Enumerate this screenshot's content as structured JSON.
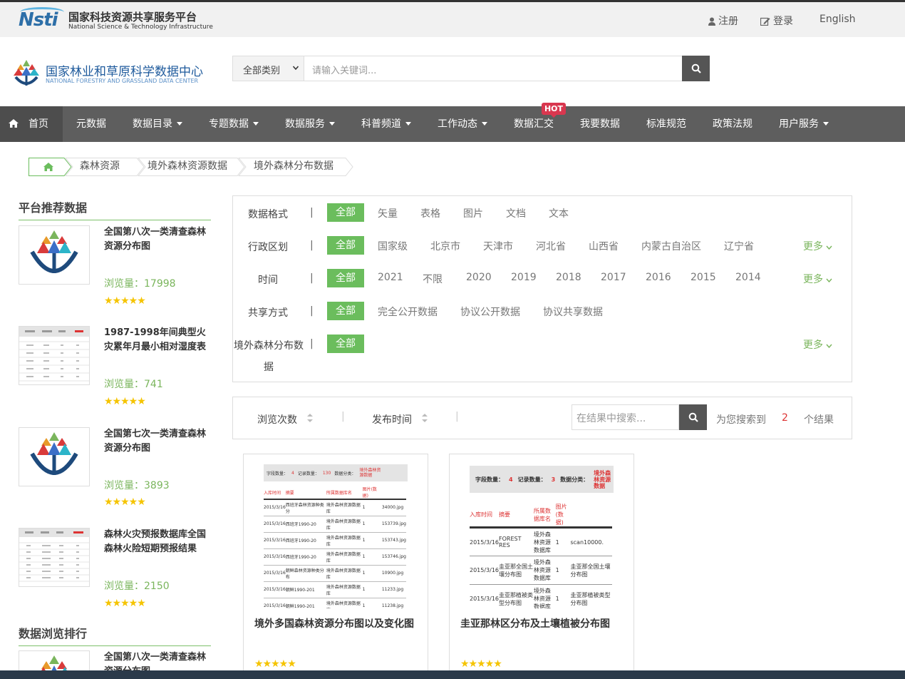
{
  "topbar": {
    "logo_cn": "国家科技资源共享服务平台",
    "logo_en": "National Science & Technology Infrastructure",
    "logo_mark": "Nsti",
    "register": "注册",
    "login": "登录",
    "english": "English"
  },
  "header": {
    "logo_cn": "国家林业和草原科学数据中心",
    "logo_en": "NATIONAL FORESTRY AND GRASSLAND DATA CENTER",
    "category": "全部类别",
    "search_placeholder": "请输入关键词..."
  },
  "nav": {
    "items": [
      "首页",
      "元数据",
      "数据目录",
      "专题数据",
      "数据服务",
      "科普频道",
      "工作动态",
      "数据汇交",
      "我要数据",
      "标准规范",
      "政策法规",
      "用户服务"
    ],
    "hot": "HOT"
  },
  "breadcrumb": [
    "森林资源",
    "境外森林资源数据",
    "境外森林分布数据"
  ],
  "sidebar": {
    "recommend_title": "平台推荐数据",
    "ranking_title": "数据浏览排行",
    "items": [
      {
        "title": "全国第八次一类清查森林资源分布图",
        "views": "浏览量：17998"
      },
      {
        "title": "1987-1998年间典型火灾累年月最小相对湿度表",
        "views": "浏览量：741"
      },
      {
        "title": "全国第七次一类清查森林资源分布图",
        "views": "浏览量：3893"
      },
      {
        "title": "森林火灾预报数据库全国森林火险短期预报结果",
        "views": "浏览量：2150"
      }
    ],
    "ranking_item": "全国第八次一类清查森林资源分布图",
    "stars": "★★★★★"
  },
  "filters": {
    "all": "全部",
    "more": "更多",
    "sep": "|",
    "format_label": "数据格式",
    "format_options": [
      "矢量",
      "表格",
      "图片",
      "文档",
      "文本"
    ],
    "region_label": "行政区划",
    "region_options": [
      "国家级",
      "北京市",
      "天津市",
      "河北省",
      "山西省",
      "内蒙古自治区",
      "辽宁省"
    ],
    "time_label": "时间",
    "time_options": [
      "2021",
      "不限",
      "2020",
      "2019",
      "2018",
      "2017",
      "2016",
      "2015",
      "2014"
    ],
    "share_label": "共享方式",
    "share_options": [
      "完全公开数据",
      "协议公开数据",
      "协议共享数据"
    ],
    "dist_label": "境外森林分布数",
    "dist_label2": "据"
  },
  "sort": {
    "views": "浏览次数",
    "date": "发布时间",
    "search_placeholder": "在结果中搜索...",
    "found_prefix": "为您搜索到",
    "count": "2",
    "found_suffix": "个结果"
  },
  "results": [
    {
      "title": "境外多国森林资源分布图以及变化图",
      "stars": "★★★★★",
      "thumb": {
        "header": [
          "字段数量：",
          "4",
          "记录数量：",
          "130",
          "数据分类：",
          "境外森林资源数据"
        ],
        "cols": [
          "入库时间",
          "摘要",
          "所属数据库名",
          "图片(数据)"
        ],
        "rows": [
          [
            "2015/3/16",
            "西班牙森林资源种类分",
            "境外森林资源数据库",
            "1",
            "34000.jpg"
          ],
          [
            "2015/3/16",
            "西班牙1990-20",
            "境外森林资源数据库",
            "1",
            "153739.jpg"
          ],
          [
            "2015/3/16",
            "西班牙1990-20",
            "境外森林资源数据库",
            "1",
            "153743.jpg"
          ],
          [
            "2015/3/16",
            "西班牙1990-20",
            "境外森林资源数据库",
            "1",
            "153746.jpg"
          ],
          [
            "2015/3/16",
            "朝鲜森林资源种类分布",
            "境外森林资源数据库",
            "1",
            "10900.jpg"
          ],
          [
            "2015/3/16",
            "朝鲜1990-201",
            "境外森林资源数据库",
            "1",
            "11233.jpg"
          ],
          [
            "2015/3/16",
            "朝鲜1990-201",
            "境外森林资源数据库",
            "1",
            "11238.jpg"
          ]
        ]
      }
    },
    {
      "title": "圭亚那林区分布及土壤植被分布图",
      "stars": "★★★★★",
      "thumb": {
        "header": [
          "字段数量：",
          "4",
          "记录数量：",
          "3",
          "数据分类：",
          "境外森林资源数据"
        ],
        "cols": [
          "入库时间",
          "摘要",
          "所属数据库名",
          "图片(数据)"
        ],
        "rows": [
          [
            "2015/3/16",
            "FOREST RES",
            "境外森林资源数据库",
            "1",
            "scan10000."
          ],
          [
            "2015/3/16",
            "圭亚那全国土壤分布图",
            "境外森林资源数据库",
            "1",
            "圭亚那全国土壤分布图"
          ],
          [
            "2015/3/16",
            "圭亚那植被类型分布图",
            "境外森林资源数据库",
            "1",
            "圭亚那植被类型分布图"
          ]
        ]
      }
    }
  ]
}
